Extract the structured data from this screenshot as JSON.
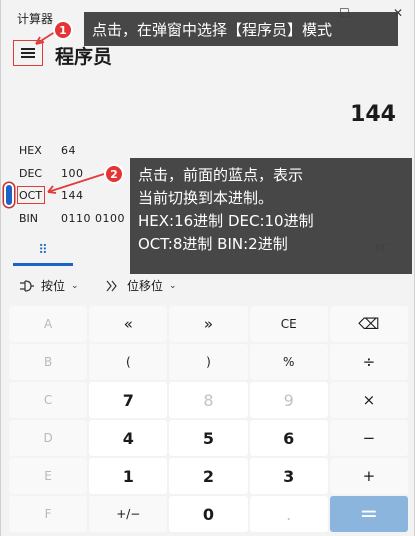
{
  "titlebar": {
    "app_title": "计算器",
    "maximize_glyph": "☐",
    "close_glyph": "✕"
  },
  "header": {
    "mode_title": "程序员"
  },
  "display": {
    "value": "144"
  },
  "radix": [
    {
      "label": "HEX",
      "value": "64"
    },
    {
      "label": "DEC",
      "value": "100"
    },
    {
      "label": "OCT",
      "value": "144"
    },
    {
      "label": "BIN",
      "value": "0110 0100"
    }
  ],
  "tabs": {
    "keypad_glyph": "⠿",
    "memory_label": "M˜"
  },
  "opbar": {
    "bitwise_label": "按位",
    "bitshift_label": "位移位",
    "chevron": "⌄"
  },
  "keypad": [
    [
      "A",
      "«",
      "»",
      "CE",
      "⌫"
    ],
    [
      "B",
      "(",
      ")",
      "%",
      "÷"
    ],
    [
      "C",
      "7",
      "8",
      "9",
      "×"
    ],
    [
      "D",
      "4",
      "5",
      "6",
      "−"
    ],
    [
      "E",
      "1",
      "2",
      "3",
      "+"
    ],
    [
      "F",
      "+/−",
      "0",
      ".",
      "="
    ]
  ],
  "annotations": {
    "badge_1": "1",
    "badge_2": "2",
    "callout_1": "点击，在弹窗中选择【程序员】模式",
    "callout_2_lines": [
      "点击，前面的蓝点，表示",
      "当前切换到本进制。",
      "HEX:16进制   DEC:10进制",
      "OCT:8进制   BIN:2进制"
    ]
  },
  "colors": {
    "accent": "#1d62c6",
    "highlight_red": "#e23b3b",
    "equals_key": "#8bb5dd",
    "callout_bg": "#404040"
  }
}
